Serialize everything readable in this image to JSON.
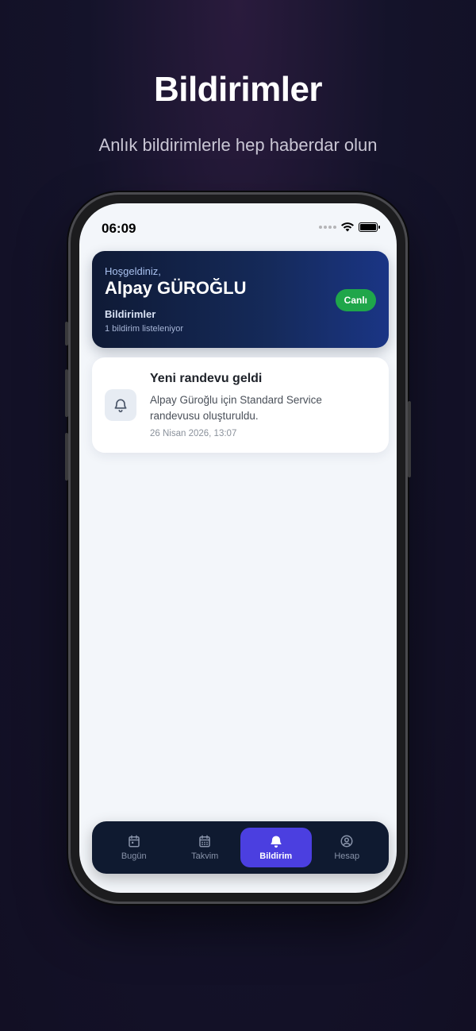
{
  "promo": {
    "title": "Bildirimler",
    "subtitle": "Anlık bildirimlerle hep haberdar olun"
  },
  "status_bar": {
    "time": "06:09"
  },
  "welcome": {
    "greeting": "Hoşgeldiniz,",
    "name": "Alpay GÜROĞLU",
    "section": "Bildirimler",
    "count_text": "1 bildirim listeleniyor",
    "live_badge": "Canlı"
  },
  "notifications": [
    {
      "icon": "bell-icon",
      "title": "Yeni randevu geldi",
      "body": "Alpay Güroğlu için Standard Service randevusu oluşturuldu.",
      "time": "26 Nisan 2026, 13:07"
    }
  ],
  "tabs": [
    {
      "label": "Bugün",
      "icon": "calendar-day-icon",
      "active": false
    },
    {
      "label": "Takvim",
      "icon": "calendar-grid-icon",
      "active": false
    },
    {
      "label": "Bildirim",
      "icon": "bell-icon",
      "active": true
    },
    {
      "label": "Hesap",
      "icon": "user-circle-icon",
      "active": false
    }
  ],
  "colors": {
    "accent": "#4b3fe0",
    "live_green": "#1fa64a",
    "card_dark": "#152a5a",
    "tab_bar": "#0f1a30"
  }
}
